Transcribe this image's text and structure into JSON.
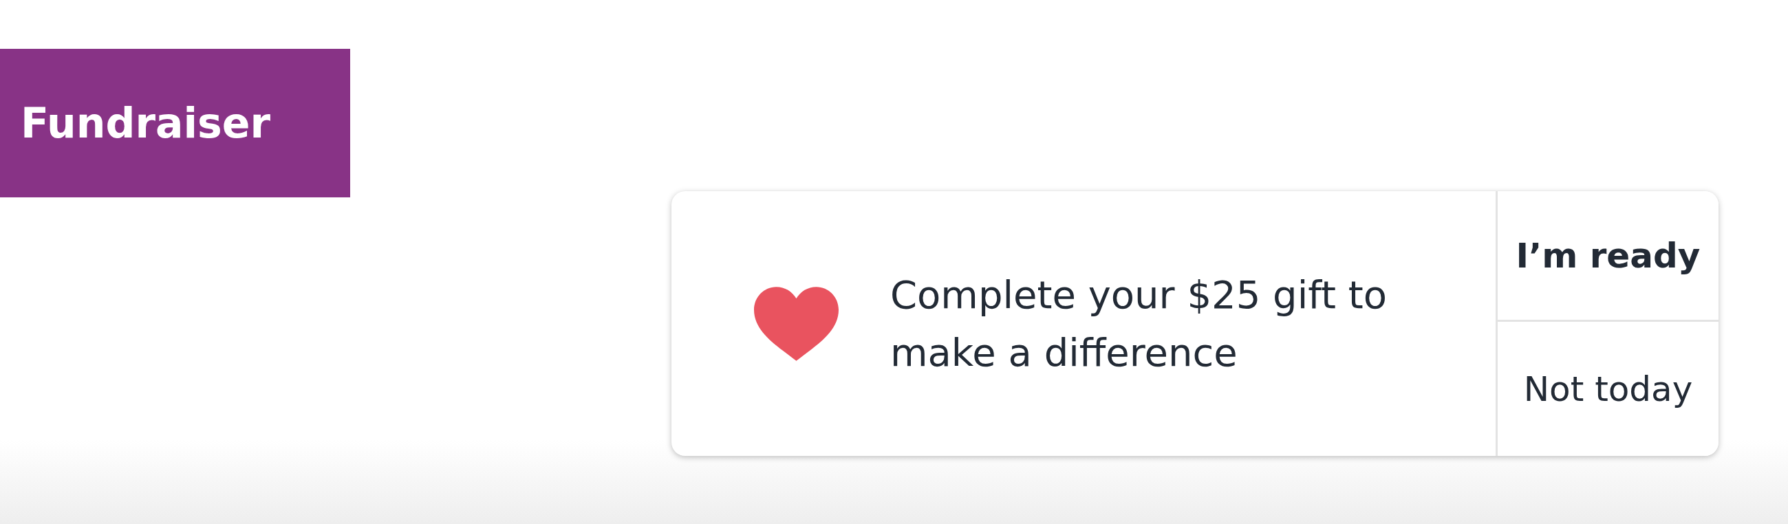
{
  "fundraiser_button": {
    "label": "Fundraiser"
  },
  "prompt": {
    "message": "Complete your $25 gift to make a difference",
    "actions": [
      {
        "label": "I’m ready",
        "kind": "primary"
      },
      {
        "label": "Not today",
        "kind": "secondary"
      }
    ]
  }
}
